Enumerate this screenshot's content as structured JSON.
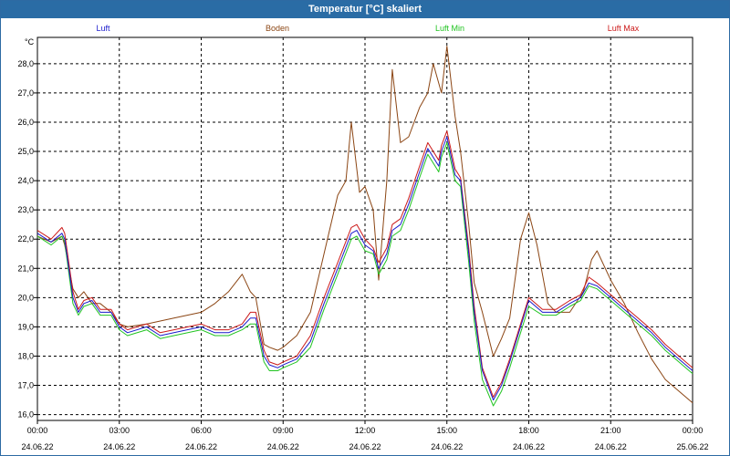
{
  "window": {
    "title": "Temperatur [°C] skaliert"
  },
  "chart_data": {
    "type": "line",
    "title": "Temperatur [°C] skaliert",
    "ylabel": "°C",
    "xlabel": "",
    "ylim": [
      15.8,
      28.9
    ],
    "yticks": [
      16.0,
      17.0,
      18.0,
      19.0,
      20.0,
      21.0,
      22.0,
      23.0,
      24.0,
      25.0,
      26.0,
      27.0,
      28.0
    ],
    "yticks_labels": [
      "16,0",
      "17,0",
      "18,0",
      "19,0",
      "20,0",
      "21,0",
      "22,0",
      "23,0",
      "24,0",
      "25,0",
      "26,0",
      "27,0",
      "28,0"
    ],
    "xlim_hours": [
      0,
      24
    ],
    "xticks": [
      {
        "hour": 0,
        "time": "00:00",
        "date": "24.06.22"
      },
      {
        "hour": 3,
        "time": "03:00",
        "date": "24.06.22"
      },
      {
        "hour": 6,
        "time": "06:00",
        "date": "24.06.22"
      },
      {
        "hour": 9,
        "time": "09:00",
        "date": "24.06.22"
      },
      {
        "hour": 12,
        "time": "12:00",
        "date": "24.06.22"
      },
      {
        "hour": 15,
        "time": "15:00",
        "date": "24.06.22"
      },
      {
        "hour": 18,
        "time": "18:00",
        "date": "24.06.22"
      },
      {
        "hour": 21,
        "time": "21:00",
        "date": "24.06.22"
      },
      {
        "hour": 24,
        "time": "00:00",
        "date": "25.06.22"
      }
    ],
    "grid": true,
    "legend_placement": "top",
    "series": [
      {
        "name": "Luft",
        "color": "#1a1acc",
        "x": [
          0,
          0.5,
          0.9,
          1.0,
          1.3,
          1.5,
          1.7,
          2.0,
          2.3,
          2.7,
          3.0,
          3.3,
          4.0,
          4.5,
          5.0,
          6.0,
          6.5,
          7.0,
          7.5,
          7.8,
          8.0,
          8.3,
          8.5,
          8.8,
          9.0,
          9.5,
          10.0,
          10.5,
          11.0,
          11.5,
          11.7,
          12.0,
          12.3,
          12.5,
          12.8,
          13.0,
          13.3,
          13.6,
          14.0,
          14.3,
          14.7,
          14.8,
          15.0,
          15.3,
          15.5,
          15.8,
          16.0,
          16.3,
          16.7,
          17.0,
          17.3,
          17.7,
          18.0,
          18.5,
          19.0,
          19.5,
          19.9,
          20.2,
          20.5,
          21.0,
          21.5,
          22.0,
          22.5,
          23.0,
          23.5,
          24.0
        ],
        "values": [
          22.2,
          21.9,
          22.2,
          22.0,
          20.0,
          19.5,
          19.8,
          19.9,
          19.5,
          19.5,
          19.0,
          18.8,
          19.0,
          18.7,
          18.8,
          19.0,
          18.8,
          18.8,
          19.0,
          19.3,
          19.3,
          18.0,
          17.7,
          17.6,
          17.7,
          17.9,
          18.5,
          19.8,
          21.0,
          22.2,
          22.3,
          21.8,
          21.6,
          21.0,
          21.5,
          22.3,
          22.5,
          23.2,
          24.3,
          25.1,
          24.5,
          25.0,
          25.5,
          24.2,
          24.0,
          21.5,
          19.5,
          17.5,
          16.5,
          17.0,
          17.8,
          19.0,
          19.9,
          19.5,
          19.5,
          19.8,
          20.0,
          20.5,
          20.4,
          20.0,
          19.6,
          19.2,
          18.8,
          18.3,
          17.9,
          17.5
        ]
      },
      {
        "name": "Boden",
        "color": "#8b4513",
        "x": [
          0,
          0.5,
          0.9,
          1.0,
          1.3,
          1.5,
          1.7,
          2.0,
          2.3,
          2.7,
          3.0,
          3.3,
          4.0,
          4.5,
          5.0,
          6.0,
          6.5,
          7.0,
          7.5,
          7.8,
          8.0,
          8.3,
          8.5,
          8.8,
          9.0,
          9.5,
          10.0,
          10.5,
          11.0,
          11.3,
          11.5,
          11.8,
          12.0,
          12.3,
          12.5,
          12.8,
          13.0,
          13.3,
          13.6,
          14.0,
          14.3,
          14.5,
          14.8,
          15.0,
          15.3,
          15.5,
          15.8,
          16.0,
          16.3,
          16.7,
          17.0,
          17.3,
          17.7,
          18.0,
          18.3,
          18.7,
          19.0,
          19.5,
          20.0,
          20.3,
          20.5,
          21.0,
          21.5,
          22.0,
          22.5,
          23.0,
          24.0
        ],
        "values": [
          22.1,
          21.9,
          22.1,
          21.8,
          20.3,
          20.0,
          20.2,
          19.8,
          19.8,
          19.5,
          19.1,
          19.0,
          19.1,
          19.2,
          19.3,
          19.5,
          19.8,
          20.2,
          20.8,
          20.2,
          20.0,
          18.4,
          18.3,
          18.2,
          18.3,
          18.7,
          19.5,
          21.5,
          23.5,
          24.0,
          26.0,
          23.6,
          23.8,
          23.0,
          20.6,
          24.0,
          27.8,
          25.3,
          25.5,
          26.5,
          27.0,
          28.0,
          27.0,
          28.6,
          26.2,
          25.0,
          22.5,
          20.5,
          19.5,
          18.0,
          18.6,
          19.3,
          22.0,
          22.9,
          21.8,
          19.8,
          19.5,
          19.5,
          20.2,
          21.3,
          21.6,
          20.6,
          19.8,
          18.8,
          17.9,
          17.2,
          16.4
        ]
      },
      {
        "name": "Luft Min",
        "color": "#22c422",
        "x": [
          0,
          0.5,
          0.9,
          1.0,
          1.3,
          1.5,
          1.7,
          2.0,
          2.3,
          2.7,
          3.0,
          3.3,
          4.0,
          4.5,
          5.0,
          6.0,
          6.5,
          7.0,
          7.5,
          7.8,
          8.0,
          8.3,
          8.5,
          8.8,
          9.0,
          9.5,
          10.0,
          10.5,
          11.0,
          11.5,
          11.7,
          12.0,
          12.3,
          12.5,
          12.8,
          13.0,
          13.3,
          13.6,
          14.0,
          14.3,
          14.7,
          14.8,
          15.0,
          15.3,
          15.5,
          15.8,
          16.0,
          16.3,
          16.7,
          17.0,
          17.3,
          17.7,
          18.0,
          18.5,
          19.0,
          19.5,
          19.9,
          20.2,
          20.5,
          21.0,
          21.5,
          22.0,
          22.5,
          23.0,
          23.5,
          24.0
        ],
        "values": [
          22.1,
          21.8,
          22.1,
          21.9,
          19.8,
          19.4,
          19.7,
          19.8,
          19.4,
          19.4,
          18.9,
          18.7,
          18.9,
          18.6,
          18.7,
          18.9,
          18.7,
          18.7,
          18.9,
          19.1,
          19.1,
          17.8,
          17.5,
          17.5,
          17.6,
          17.8,
          18.3,
          19.6,
          20.8,
          22.0,
          22.1,
          21.6,
          21.5,
          20.8,
          21.3,
          22.1,
          22.3,
          23.0,
          24.1,
          24.9,
          24.3,
          24.8,
          25.3,
          24.0,
          23.8,
          21.2,
          19.2,
          17.2,
          16.3,
          16.8,
          17.6,
          18.8,
          19.7,
          19.4,
          19.4,
          19.7,
          19.9,
          20.4,
          20.3,
          19.9,
          19.5,
          19.1,
          18.7,
          18.2,
          17.8,
          17.4
        ]
      },
      {
        "name": "Luft Max",
        "color": "#cc1a1a",
        "x": [
          0,
          0.5,
          0.9,
          1.0,
          1.3,
          1.5,
          1.7,
          2.0,
          2.3,
          2.7,
          3.0,
          3.3,
          4.0,
          4.5,
          5.0,
          6.0,
          6.5,
          7.0,
          7.5,
          7.8,
          8.0,
          8.3,
          8.5,
          8.8,
          9.0,
          9.5,
          10.0,
          10.5,
          11.0,
          11.5,
          11.7,
          12.0,
          12.3,
          12.5,
          12.8,
          13.0,
          13.3,
          13.6,
          14.0,
          14.3,
          14.7,
          14.8,
          15.0,
          15.3,
          15.5,
          15.8,
          16.0,
          16.3,
          16.7,
          17.0,
          17.3,
          17.7,
          18.0,
          18.5,
          19.0,
          19.5,
          19.9,
          20.2,
          20.5,
          21.0,
          21.5,
          22.0,
          22.5,
          23.0,
          23.5,
          24.0
        ],
        "values": [
          22.3,
          22.0,
          22.4,
          22.2,
          20.2,
          19.6,
          19.9,
          20.0,
          19.6,
          19.6,
          19.1,
          18.9,
          19.1,
          18.8,
          18.9,
          19.1,
          18.9,
          18.9,
          19.1,
          19.5,
          19.5,
          18.2,
          17.8,
          17.7,
          17.8,
          18.0,
          18.7,
          20.0,
          21.2,
          22.4,
          22.5,
          22.0,
          21.7,
          21.2,
          21.7,
          22.5,
          22.7,
          23.4,
          24.5,
          25.3,
          24.7,
          25.2,
          25.7,
          24.4,
          24.1,
          21.7,
          19.7,
          17.6,
          16.6,
          17.1,
          17.9,
          19.1,
          20.0,
          19.6,
          19.6,
          19.9,
          20.1,
          20.7,
          20.5,
          20.1,
          19.7,
          19.3,
          18.9,
          18.4,
          18.0,
          17.6
        ]
      }
    ]
  }
}
